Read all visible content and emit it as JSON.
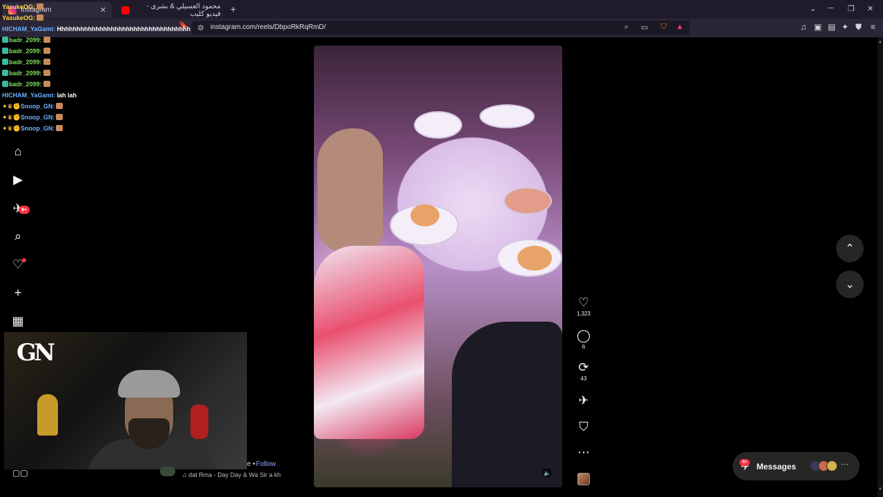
{
  "browser": {
    "tabs": [
      {
        "label": "Instagram",
        "active": true
      },
      {
        "label": "محمود العسيلي & بشرى - فيديو كليب",
        "active": false
      }
    ],
    "new_tab": "+",
    "url": "instagram.com/reels/DbpoRkRqRmD/"
  },
  "chat": [
    {
      "user": "YasukeOG:",
      "msg": "",
      "color": "yellow"
    },
    {
      "user": "YasukeOG:",
      "msg": "",
      "color": "yellow"
    },
    {
      "user": "HICHAM_YaGami:",
      "msg": "Hhhhhhhhhhhhhhhhhhhhhhhhhhhhhhhhhhh",
      "color": "blue"
    },
    {
      "user": "badr_2099:",
      "msg": "",
      "color": "green"
    },
    {
      "user": "badr_2099:",
      "msg": "",
      "color": "green"
    },
    {
      "user": "badr_2099:",
      "msg": "",
      "color": "green"
    },
    {
      "user": "badr_2099:",
      "msg": "",
      "color": "green"
    },
    {
      "user": "badr_2099:",
      "msg": "",
      "color": "green"
    },
    {
      "user": "HICHAM_YaGami:",
      "msg": "lah lah",
      "color": "blue"
    },
    {
      "user": "Snoop_GN:",
      "msg": "",
      "color": "blue"
    },
    {
      "user": "Snoop_GN:",
      "msg": "",
      "color": "blue"
    },
    {
      "user": "Snoop_GN:",
      "msg": "",
      "color": "blue"
    }
  ],
  "nav": {
    "messages_badge": "9+"
  },
  "reel": {
    "likes": "1,323",
    "comments": "6",
    "reposts": "43",
    "follow": "Follow",
    "follow_sep": "e •",
    "audio": "dat Rma - Day Day & Wa Sir a kh"
  },
  "messages": {
    "label": "Messages",
    "badge": "9+"
  },
  "colors": {
    "accent": "#ff3040",
    "follow": "#9aa6ff"
  }
}
